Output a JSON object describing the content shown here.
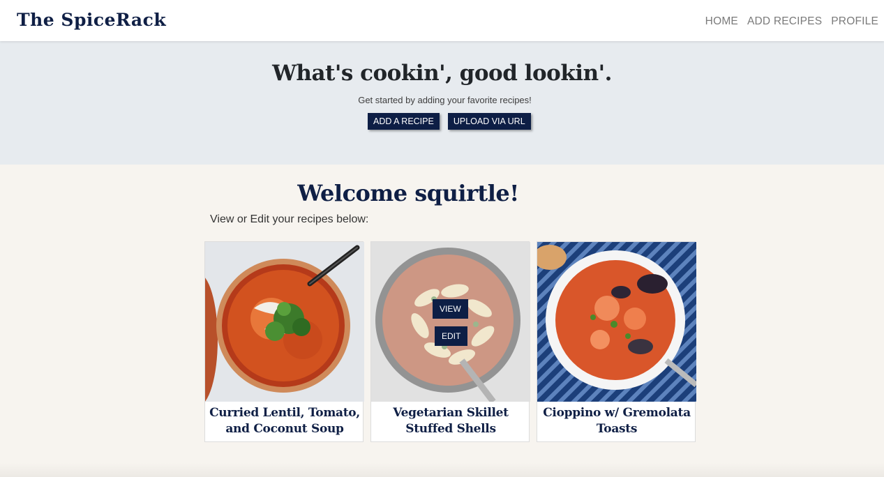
{
  "navbar": {
    "brand": "The SpiceRack",
    "links": [
      "HOME",
      "ADD RECIPES",
      "PROFILE"
    ]
  },
  "hero": {
    "title": "What's cookin', good lookin'.",
    "subtitle": "Get started by adding your favorite recipes!",
    "add_button": "ADD A RECIPE",
    "upload_button": "UPLOAD VIA URL"
  },
  "welcome": {
    "title": "Welcome squirtle!",
    "subtitle": "View or Edit your recipes below:"
  },
  "recipes": [
    {
      "title": "Curried Lentil, Tomato, and Coconut Soup"
    },
    {
      "title": "Vegetarian Skillet Stuffed Shells",
      "view_label": "VIEW",
      "edit_label": "EDIT"
    },
    {
      "title": "Cioppino w/ Gremolata Toasts"
    }
  ],
  "colors": {
    "brand": "#0f1f45",
    "button": "#0d1e45",
    "hero_bg": "#e7ebef",
    "page_bg": "#f7f4ef"
  }
}
